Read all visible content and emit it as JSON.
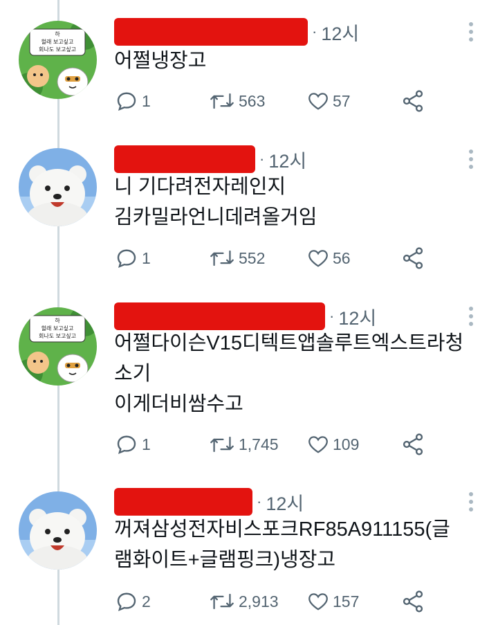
{
  "tweets": [
    {
      "avatar": "sheep-cartoon-avatar",
      "avatar_caption": [
        "하",
        "헐래 보고싶고",
        "회나도 보고싶고"
      ],
      "time": "12시",
      "lines": [
        "어쩔냉장고"
      ],
      "replies": "1",
      "retweets": "563",
      "likes": "57"
    },
    {
      "avatar": "white-bear-avatar",
      "time": "12시",
      "lines": [
        "니 기다려전자레인지",
        "김카밀라언니데려올거임"
      ],
      "replies": "1",
      "retweets": "552",
      "likes": "56"
    },
    {
      "avatar": "sheep-cartoon-avatar",
      "avatar_caption": [
        "하",
        "헐래 보고싶고",
        "회나도 보고싶고"
      ],
      "time": "12시",
      "lines": [
        "어쩔다이슨V15디텍트앱솔루트엑스트라청",
        "소기",
        "이게더비쌈수고"
      ],
      "replies": "1",
      "retweets": "1,745",
      "likes": "109"
    },
    {
      "avatar": "white-bear-avatar",
      "time": "12시",
      "lines": [
        "꺼져삼성전자비스포크RF85A911155(글",
        "램화이트+글램핑크)냉장고"
      ],
      "replies": "2",
      "retweets": "2,913",
      "likes": "157"
    }
  ],
  "icons": {
    "reply": "reply-icon",
    "retweet": "retweet-icon",
    "like": "heart-icon",
    "share": "share-icon",
    "more": "more-options-icon"
  },
  "colors": {
    "redaction": "#e3130f",
    "muted": "#536471",
    "text": "#0f1419",
    "thread_line": "#cfd9de"
  }
}
